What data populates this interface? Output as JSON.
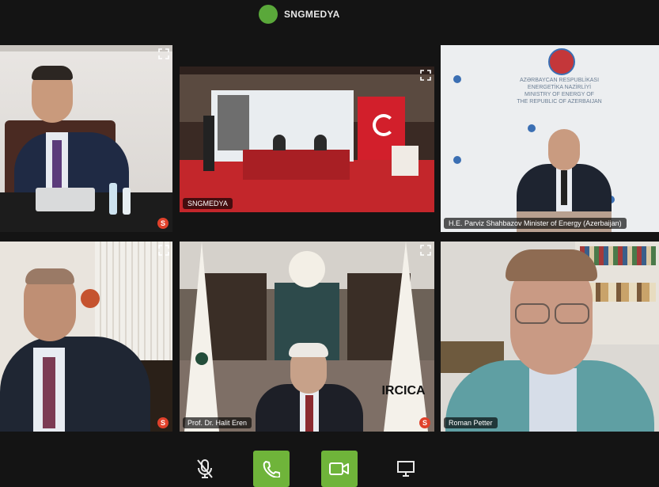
{
  "meeting": {
    "host_name": "SNGMEDYA",
    "host_avatar_color": "#5aa83a"
  },
  "tiles": [
    {
      "name_label": "",
      "muted": true
    },
    {
      "name_label": "SNGMEDYA",
      "muted": false
    },
    {
      "name_label": "H.E. Parviz Shahbazov Minister of Energy (Azerbaijan)",
      "muted": false
    },
    {
      "name_label": "",
      "muted": true
    },
    {
      "name_label": "Prof. Dr. Halit Eren",
      "muted": true
    },
    {
      "name_label": "Roman Petter",
      "muted": false
    }
  ],
  "scene_text": {
    "ministry_line1": "AZƏRBAYCAN RESPUBLİKASI",
    "ministry_line2": "ENERGETİKA NAZİRLİYİ",
    "ministry_line3": "MINISTRY OF ENERGY OF",
    "ministry_line4": "THE REPUBLIC OF AZERBAIJAN",
    "flag_text": "IRCICA"
  },
  "controls": {
    "mic_icon": "mic-muted-icon",
    "phone_icon": "phone-icon",
    "video_icon": "video-camera-icon",
    "share_icon": "screen-share-icon",
    "accent_color": "#6fb43a",
    "mute_badge_color": "#e0412b"
  }
}
